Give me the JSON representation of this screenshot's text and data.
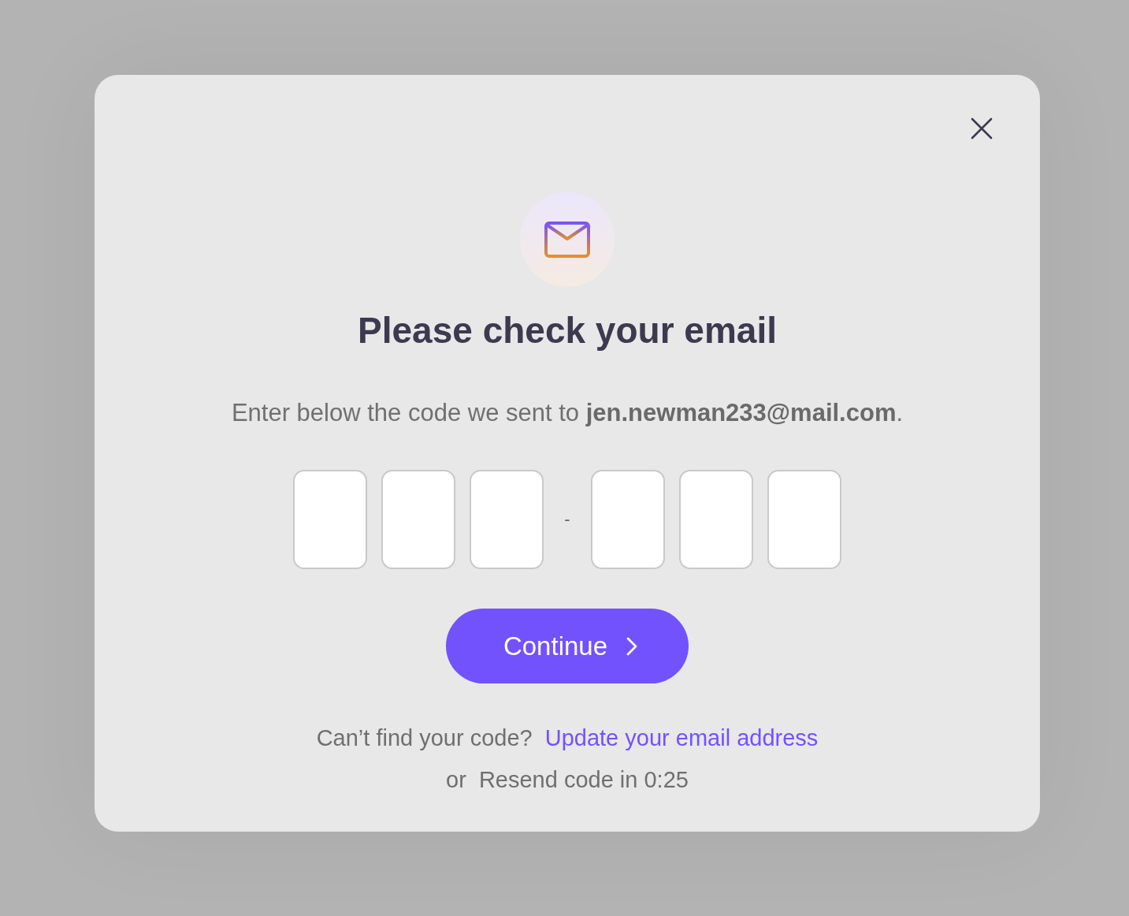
{
  "dialog": {
    "title": "Please check your email",
    "description": "Enter below the code we sent to **jen.newman233@mail.com**.",
    "code_fields": [
      {
        "kind": "digit"
      },
      {
        "kind": "digit"
      },
      {
        "kind": "digit"
      },
      {
        "kind": "separator",
        "text": "-"
      },
      {
        "kind": "digit"
      },
      {
        "kind": "digit"
      },
      {
        "kind": "digit"
      }
    ],
    "continue_button": "Continue",
    "help_text": "Can’t find your code?",
    "help_link": "Update your email address",
    "or_text": "or",
    "resend_text": "Resend code in 0:25"
  }
}
